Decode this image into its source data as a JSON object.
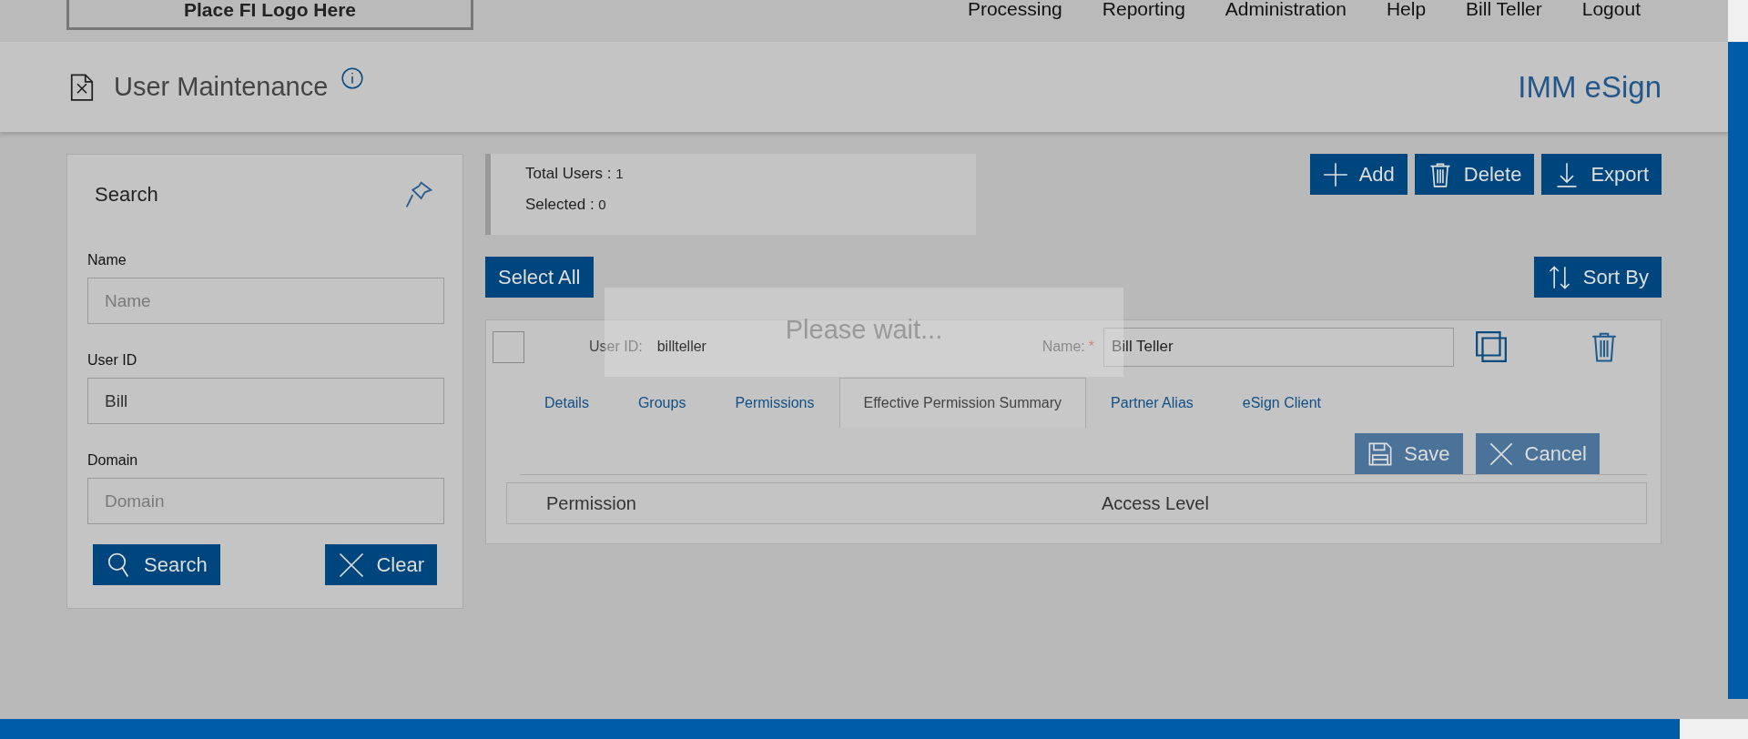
{
  "header": {
    "logo_text": "Place FI Logo Here",
    "nav": [
      "Processing",
      "Reporting",
      "Administration",
      "Help",
      "Bill Teller",
      "Logout"
    ]
  },
  "page": {
    "title": "User Maintenance",
    "brand": "IMM eSign"
  },
  "search_panel": {
    "title": "Search",
    "fields": [
      {
        "label": "Name",
        "placeholder": "Name"
      },
      {
        "label": "User ID",
        "value": "Bill"
      },
      {
        "label": "Domain",
        "placeholder": "Domain"
      }
    ],
    "buttons": [
      "Search",
      "Clear"
    ]
  },
  "summary": [
    {
      "label": "Total Users :",
      "value": "1"
    },
    {
      "label": "Selected :",
      "value": "0"
    }
  ],
  "actions": [
    "Add",
    "Delete",
    "Export"
  ],
  "select_all": "Select All",
  "sort_by": "Sort By",
  "user": {
    "checked": false,
    "user_id_label": "User ID:",
    "user_id": "billteller",
    "name_label": "Name:",
    "required_mark": "*",
    "name": "Bill Teller",
    "tabs": [
      {
        "label": "Details",
        "selected": false
      },
      {
        "label": "Groups",
        "selected": false
      },
      {
        "label": "Permissions",
        "selected": false
      },
      {
        "label": "Effective Permission Summary",
        "selected": true
      },
      {
        "label": "Partner Alias",
        "selected": false
      },
      {
        "label": "eSign Client",
        "selected": false
      }
    ],
    "buttons": [
      "Save",
      "Cancel"
    ],
    "table": {
      "columns": [
        "Permission",
        "Access Level"
      ]
    }
  },
  "loading": {
    "message": "Please wait..."
  }
}
